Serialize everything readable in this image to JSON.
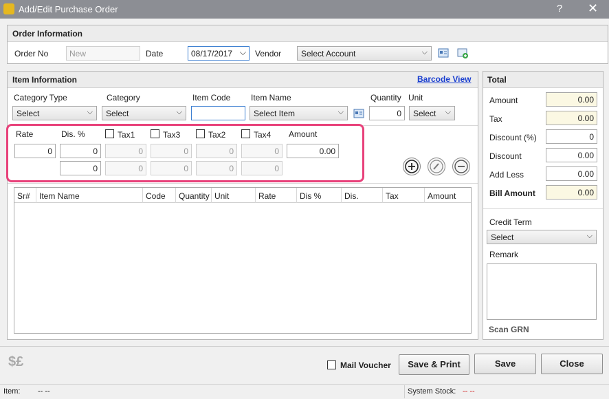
{
  "window": {
    "title": "Add/Edit Purchase Order",
    "help": "?",
    "close": "✕"
  },
  "order_info": {
    "heading": "Order Information",
    "order_no_label": "Order No",
    "order_no_value": "New",
    "date_label": "Date",
    "date_value": "08/17/2017",
    "vendor_label": "Vendor",
    "vendor_value": "Select Account"
  },
  "item_info": {
    "heading": "Item Information",
    "barcode_link": "Barcode View",
    "category_type_label": "Category Type",
    "category_type_value": "Select",
    "category_label": "Category",
    "category_value": "Select",
    "item_code_label": "Item Code",
    "item_code_value": "",
    "item_name_label": "Item Name",
    "item_name_value": "Select Item",
    "quantity_label": "Quantity",
    "quantity_value": "0",
    "unit_label": "Unit",
    "unit_value": "Select",
    "rate_label": "Rate",
    "dis_label": "Dis. %",
    "tax1_label": "Tax1",
    "tax3_label": "Tax3",
    "tax2_label": "Tax2",
    "tax4_label": "Tax4",
    "amount_label": "Amount",
    "row1": {
      "rate": "0",
      "dis": "0",
      "tax1": "0",
      "tax3": "0",
      "tax2": "0",
      "tax4": "0",
      "amount": "0.00"
    },
    "row2": {
      "dis": "0",
      "tax1": "0",
      "tax3": "0",
      "tax2": "0",
      "tax4": "0"
    }
  },
  "grid": {
    "columns": [
      "Sr#",
      "Item Name",
      "Code",
      "Quantity",
      "Unit",
      "Rate",
      "Dis %",
      "Dis.",
      "Tax",
      "Amount"
    ]
  },
  "total": {
    "heading": "Total",
    "amount_label": "Amount",
    "amount_value": "0.00",
    "tax_label": "Tax",
    "tax_value": "0.00",
    "discount_pct_label": "Discount (%)",
    "discount_pct_value": "0",
    "discount_label": "Discount",
    "discount_value": "0.00",
    "add_less_label": "Add Less",
    "add_less_value": "0.00",
    "bill_amount_label": "Bill Amount",
    "bill_amount_value": "0.00",
    "credit_term_label": "Credit Term",
    "credit_term_value": "Select",
    "remark_label": "Remark",
    "scan_grn": "Scan GRN"
  },
  "footer": {
    "mail_voucher": "Mail Voucher",
    "save_print": "Save & Print",
    "save": "Save",
    "close": "Close"
  },
  "status": {
    "item_label": "Item:",
    "item_value": "-- --",
    "stock_label": "System Stock:",
    "stock_value": "-- --"
  }
}
